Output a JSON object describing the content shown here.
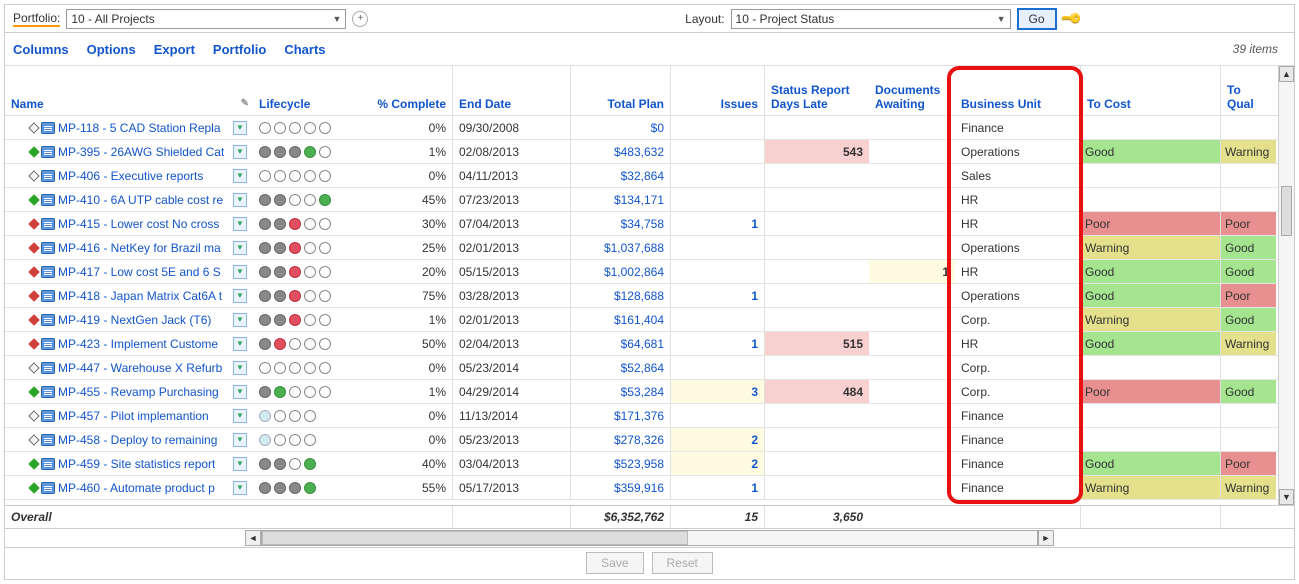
{
  "toolbar": {
    "portfolio_label": "Portfolio:",
    "portfolio_value": "10 - All Projects",
    "layout_label": "Layout:",
    "layout_value": "10 - Project Status",
    "go_label": "Go",
    "add_label": "+"
  },
  "menu": {
    "columns": "Columns",
    "options": "Options",
    "export": "Export",
    "portfolio": "Portfolio",
    "charts": "Charts",
    "items_count": "39 items"
  },
  "headers": {
    "name": "Name",
    "lifecycle": "Lifecycle",
    "pct": "% Complete",
    "end": "End Date",
    "plan": "Total Plan",
    "issues": "Issues",
    "status_report": "Status Report",
    "days_late": "Days Late",
    "docs": "Documents",
    "awaiting": "Awaiting",
    "bu": "Business Unit",
    "cost": "To Cost",
    "qual": "To Qual"
  },
  "rows": [
    {
      "disc": "empty",
      "name": "MP-118 - 5 CAD Station Repla",
      "life": [
        "",
        "",
        "",
        "",
        ""
      ],
      "pct": "0%",
      "end": "09/30/2008",
      "plan": "$0",
      "iss": "",
      "days": "",
      "docs": "",
      "bu": "Finance",
      "cost": "",
      "qual": ""
    },
    {
      "disc": "green",
      "name": "MP-395 - 26AWG Shielded Cat",
      "life": [
        "g",
        "g",
        "g",
        "gr",
        ""
      ],
      "pct": "1%",
      "end": "02/08/2013",
      "plan": "$483,632",
      "iss": "",
      "days": "543",
      "days_hl": "pink",
      "docs": "",
      "bu": "Operations",
      "cost": "Good",
      "qual": "Warning"
    },
    {
      "disc": "empty",
      "name": "MP-406 - Executive reports",
      "life": [
        "",
        "",
        "",
        "",
        ""
      ],
      "pct": "0%",
      "end": "04/11/2013",
      "plan": "$32,864",
      "iss": "",
      "days": "",
      "docs": "",
      "bu": "Sales",
      "cost": "",
      "qual": ""
    },
    {
      "disc": "green",
      "name": "MP-410 - 6A UTP cable cost re",
      "life": [
        "g",
        "g",
        "",
        "",
        "gr"
      ],
      "pct": "45%",
      "end": "07/23/2013",
      "plan": "$134,171",
      "iss": "",
      "days": "",
      "docs": "",
      "bu": "HR",
      "cost": "",
      "qual": ""
    },
    {
      "disc": "red",
      "name": "MP-415 - Lower cost No cross",
      "life": [
        "g",
        "g",
        "r",
        "",
        ""
      ],
      "pct": "30%",
      "end": "07/04/2013",
      "plan": "$34,758",
      "iss": "1",
      "days": "",
      "docs": "",
      "bu": "HR",
      "cost": "Poor",
      "qual": "Poor"
    },
    {
      "disc": "red",
      "name": "MP-416 - NetKey for Brazil ma",
      "life": [
        "g",
        "g",
        "r",
        "",
        ""
      ],
      "pct": "25%",
      "end": "02/01/2013",
      "plan": "$1,037,688",
      "iss": "",
      "days": "",
      "docs": "",
      "bu": "Operations",
      "cost": "Warning",
      "qual": "Good"
    },
    {
      "disc": "red",
      "name": "MP-417 - Low cost 5E and 6 S",
      "life": [
        "g",
        "g",
        "r",
        "",
        ""
      ],
      "pct": "20%",
      "end": "05/15/2013",
      "plan": "$1,002,864",
      "iss": "",
      "days": "",
      "docs": "1",
      "docs_hl": "yellow",
      "bu": "HR",
      "cost": "Good",
      "qual": "Good"
    },
    {
      "disc": "red",
      "name": "MP-418 - Japan Matrix Cat6A t",
      "life": [
        "g",
        "g",
        "r",
        "",
        ""
      ],
      "pct": "75%",
      "end": "03/28/2013",
      "plan": "$128,688",
      "iss": "1",
      "days": "",
      "docs": "",
      "bu": "Operations",
      "cost": "Good",
      "qual": "Poor"
    },
    {
      "disc": "red",
      "name": "MP-419 - NextGen Jack (T6)",
      "life": [
        "g",
        "g",
        "r",
        "",
        ""
      ],
      "pct": "1%",
      "end": "02/01/2013",
      "plan": "$161,404",
      "iss": "",
      "days": "",
      "docs": "",
      "bu": "Corp.",
      "cost": "Warning",
      "qual": "Good"
    },
    {
      "disc": "red",
      "name": "MP-423 - Implement Custome",
      "life": [
        "g",
        "r",
        "",
        "",
        ""
      ],
      "pct": "50%",
      "end": "02/04/2013",
      "plan": "$64,681",
      "iss": "1",
      "days": "515",
      "days_hl": "pink",
      "docs": "",
      "bu": "HR",
      "cost": "Good",
      "qual": "Warning"
    },
    {
      "disc": "empty",
      "name": "MP-447 - Warehouse X Refurb",
      "life": [
        "",
        "",
        "",
        "",
        ""
      ],
      "pct": "0%",
      "end": "05/23/2014",
      "plan": "$52,864",
      "iss": "",
      "days": "",
      "docs": "",
      "bu": "Corp.",
      "cost": "",
      "qual": ""
    },
    {
      "disc": "green",
      "name": "MP-455 - Revamp Purchasing",
      "life": [
        "g",
        "gr",
        "",
        "",
        ""
      ],
      "pct": "1%",
      "end": "04/29/2014",
      "plan": "$53,284",
      "iss": "3",
      "iss_hl": "yellow",
      "days": "484",
      "days_hl": "pink",
      "docs": "",
      "bu": "Corp.",
      "cost": "Poor",
      "qual": "Good"
    },
    {
      "disc": "empty",
      "name": "MP-457 - Pilot implemantion",
      "life": [
        "lt",
        "",
        "",
        ""
      ],
      "pct": "0%",
      "end": "11/13/2014",
      "plan": "$171,376",
      "iss": "",
      "days": "",
      "docs": "",
      "bu": "Finance",
      "cost": "",
      "qual": ""
    },
    {
      "disc": "empty",
      "name": "MP-458 - Deploy to remaining",
      "life": [
        "lt",
        "",
        "",
        ""
      ],
      "pct": "0%",
      "end": "05/23/2013",
      "plan": "$278,326",
      "iss": "2",
      "iss_hl": "yellow",
      "days": "",
      "docs": "",
      "bu": "Finance",
      "cost": "",
      "qual": ""
    },
    {
      "disc": "green",
      "name": "MP-459 - Site statistics report",
      "life": [
        "g",
        "g",
        "",
        "gr"
      ],
      "pct": "40%",
      "end": "03/04/2013",
      "plan": "$523,958",
      "iss": "2",
      "iss_hl": "yellow",
      "days": "",
      "docs": "",
      "bu": "Finance",
      "cost": "Good",
      "qual": "Poor"
    },
    {
      "disc": "green",
      "name": "MP-460 - Automate product p",
      "life": [
        "g",
        "g",
        "g",
        "gr"
      ],
      "pct": "55%",
      "end": "05/17/2013",
      "plan": "$359,916",
      "iss": "1",
      "days": "",
      "docs": "",
      "bu": "Finance",
      "cost": "Warning",
      "qual": "Warning"
    }
  ],
  "overall": {
    "label": "Overall",
    "plan": "$6,352,762",
    "issues": "15",
    "days": "3,650"
  },
  "buttons": {
    "save": "Save",
    "reset": "Reset"
  },
  "status_labels": {
    "Good": "Good",
    "Warning": "Warning",
    "Poor": "Poor"
  }
}
